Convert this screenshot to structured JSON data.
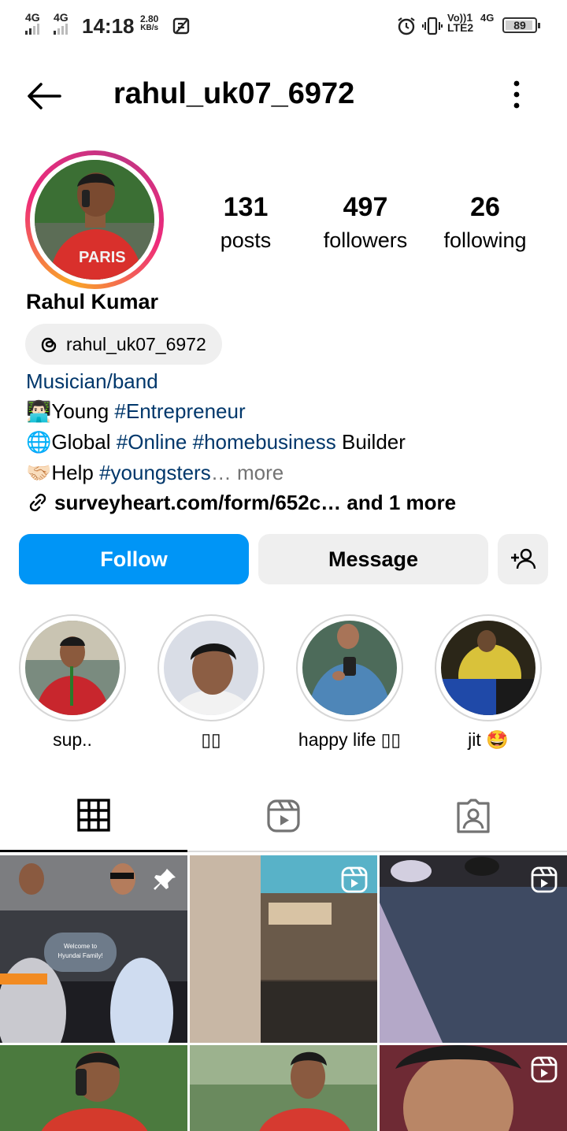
{
  "status_bar": {
    "network1": "4G",
    "network2": "4G",
    "time": "14:18",
    "speed_value": "2.80",
    "speed_unit": "KB/s",
    "volte": "Vo))",
    "lte": "LTE2",
    "sim": "1",
    "net_right": "4G",
    "battery": "89"
  },
  "header": {
    "username": "rahul_uk07_6972",
    "back_icon": "arrow-left-icon",
    "menu_icon": "kebab-menu-icon"
  },
  "profile": {
    "stats": [
      {
        "value": "131",
        "label": "posts"
      },
      {
        "value": "497",
        "label": "followers"
      },
      {
        "value": "26",
        "label": "following"
      }
    ],
    "full_name": "Rahul Kumar",
    "threads_handle": "rahul_uk07_6972",
    "category": "Musician/band",
    "bio": {
      "line1_emoji": "👨🏻‍💻",
      "line1_text": "Young ",
      "line1_tag": "#Entrepreneur",
      "line2_emoji": "🌐",
      "line2_tag1": "#Online",
      "line2_tag2": "#homebusiness",
      "line2_text": " Builder",
      "line2_pre": "Global ",
      "line3_emoji": "🤝🏻",
      "line3_text": "Help ",
      "line3_tag": "#youngsters",
      "line3_more": "… more"
    },
    "link_text": "surveyheart.com/form/652c… and 1 more"
  },
  "actions": {
    "follow": "Follow",
    "message": "Message",
    "add_user_icon": "add-user-icon"
  },
  "highlights": [
    {
      "label": "sup.."
    },
    {
      "label": "▯▯"
    },
    {
      "label": "happy life ▯▯"
    },
    {
      "label": "jit 🤩"
    }
  ],
  "tabs": [
    {
      "icon": "grid-icon",
      "active": true
    },
    {
      "icon": "reels-icon",
      "active": false
    },
    {
      "icon": "tagged-icon",
      "active": false
    }
  ],
  "posts": {
    "first_post_sign": "Welcome to Hyundai Family!",
    "first_post_badge": "pin-icon",
    "reel_badges": "reels-icon"
  },
  "colors": {
    "follow_button": "#0095f6",
    "link": "#00376b",
    "secondary_button": "#efefef"
  }
}
